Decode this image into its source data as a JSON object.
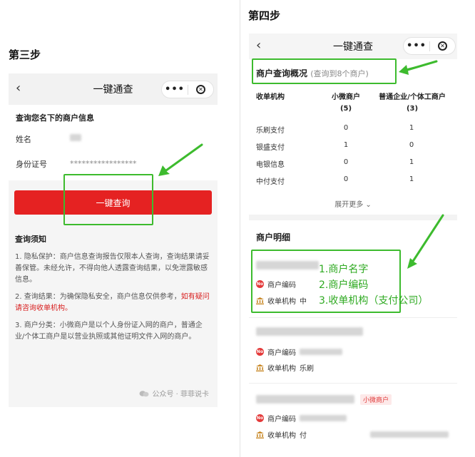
{
  "left_step": "第三步",
  "right_step": "第四步",
  "left_screen": {
    "nav_title": "一键通查",
    "section_title": "查询您名下的商户信息",
    "name_label": "姓名",
    "id_label": "身份证号",
    "id_value": "*****************",
    "query_button": "一键查询",
    "notice_title": "查询须知",
    "notice_1": "1. 隐私保护：商户信息查询报告仅限本人查询，查询结果请妥善保管。未经允许，不得向他人透露查询结果，以免泄露敏感信息。",
    "notice_2_prefix": "2. 查询结果：为确保隐私安全，商户信息仅供参考，",
    "notice_2_red": "如有疑问请咨询收单机构。",
    "notice_3": "3. 商户分类：小微商户是以个人身份证入网的商户，普通企业/个体工商户是以营业执照或其他证明文件入网的商户。",
    "watermark": "公众号 · 菲菲说卡"
  },
  "right_screen": {
    "nav_title": "一键通查",
    "overview_title": "商户查询概况",
    "overview_sub": "(查询到8个商户)",
    "col_agency": "收单机构",
    "col_micro": "小微商户",
    "col_micro_count": "(5)",
    "col_corp": "普通企业/个体工商户",
    "col_corp_count": "(3)",
    "rows": [
      {
        "name": "乐刷支付",
        "micro": "0",
        "corp": "1"
      },
      {
        "name": "银盛支付",
        "micro": "1",
        "corp": "0"
      },
      {
        "name": "电银信息",
        "micro": "0",
        "corp": "1"
      },
      {
        "name": "中付支付",
        "micro": "0",
        "corp": "1"
      }
    ],
    "expand_more": "展开更多",
    "detail_title": "商户明细",
    "code_label": "商户编码",
    "agency_label": "收单机构",
    "m1_agency_partial": "中",
    "m2_agency_partial": "乐刷",
    "m3_agency_partial": "付",
    "micro_tag": "小微商户"
  },
  "annotations": {
    "line1": "1.商户名字",
    "line2": "2.商户编码",
    "line3": "3.收单机构（支付公司）"
  },
  "colors": {
    "accent_red": "#e52222",
    "annotation_green": "#3dbb2e"
  }
}
